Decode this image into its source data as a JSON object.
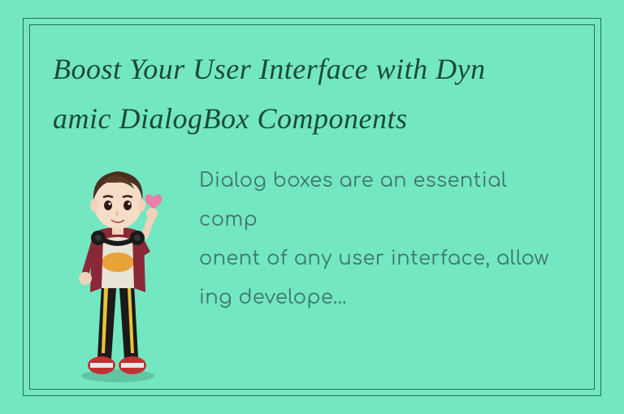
{
  "title_line1": "Boost Your User Interface with Dyn",
  "title_line2": "amic DialogBox Components",
  "body_line1": "Dialog boxes are an essential comp",
  "body_line2": "onent of any user interface, allow",
  "body_line3": "ing develope…"
}
